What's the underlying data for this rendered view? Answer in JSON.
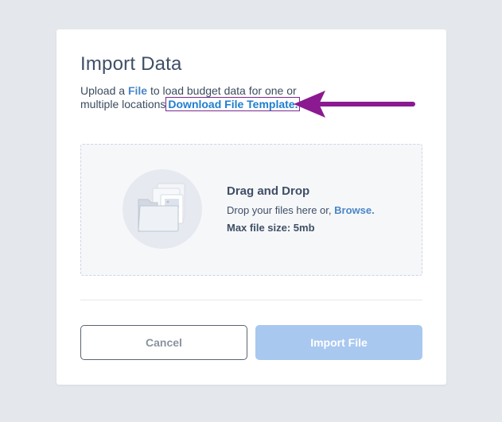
{
  "modal": {
    "title": "Import Data",
    "description": {
      "prefix": "Upload a ",
      "file_link": "File",
      "middle": " to load budget data for one or multiple locations",
      "download_link": "Download File Template."
    },
    "dropzone": {
      "icon": "folder-files-icon",
      "title": "Drag and Drop",
      "instructions_prefix": "Drop your files here or, ",
      "browse_link": "Browse.",
      "max_size": "Max file size: 5mb"
    },
    "buttons": {
      "cancel": "Cancel",
      "import": "Import File"
    }
  },
  "colors": {
    "background": "#e4e8ec",
    "link": "#1f7ecf",
    "annotation": "#8b1a91",
    "import_disabled": "#a8c8ef"
  }
}
